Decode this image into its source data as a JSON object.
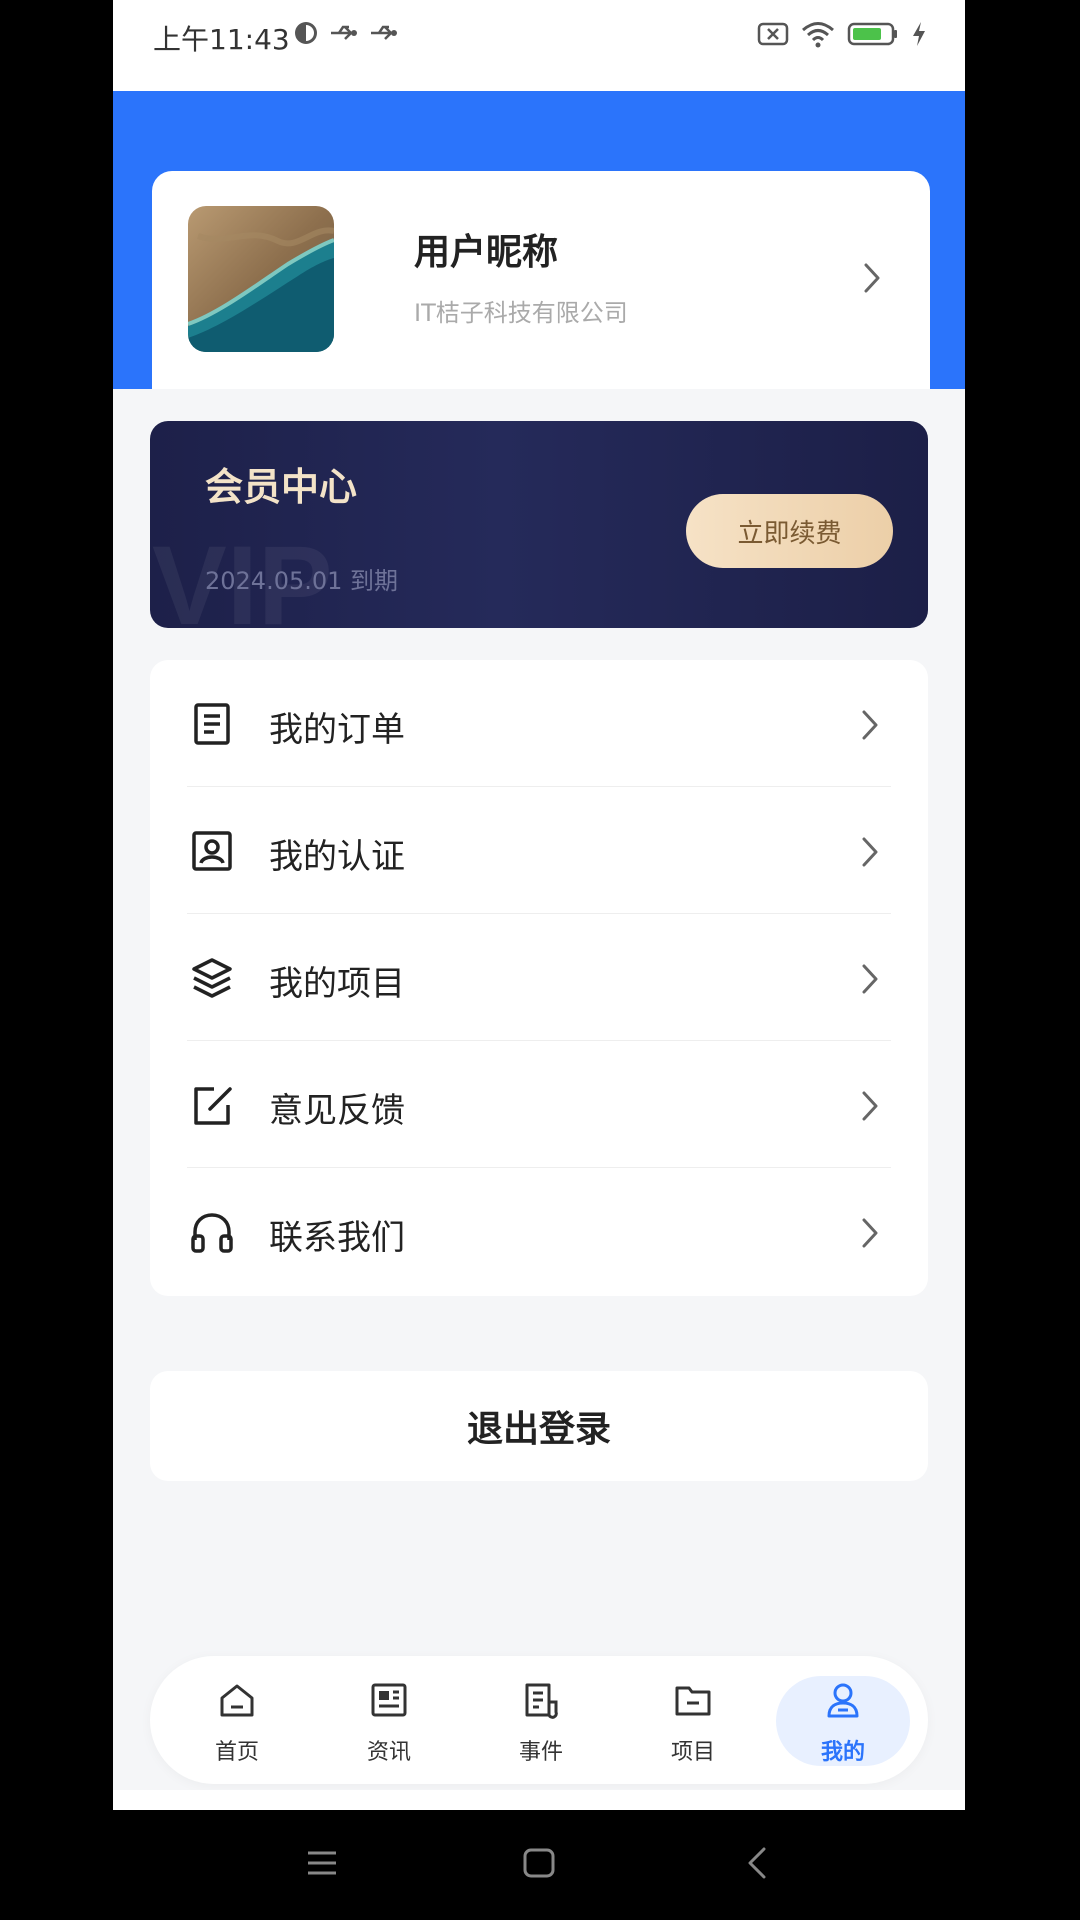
{
  "status_bar": {
    "time": "上午11:43"
  },
  "profile": {
    "nickname": "用户昵称",
    "company": "IT桔子科技有限公司"
  },
  "vip": {
    "title": "会员中心",
    "watermark": "VIP",
    "expire": "2024.05.01 到期",
    "renew_label": "立即续费"
  },
  "menu": {
    "items": [
      {
        "label": "我的订单",
        "icon": "order-icon"
      },
      {
        "label": "我的认证",
        "icon": "certification-icon"
      },
      {
        "label": "我的项目",
        "icon": "layers-icon"
      },
      {
        "label": "意见反馈",
        "icon": "feedback-icon"
      },
      {
        "label": "联系我们",
        "icon": "headphones-icon"
      }
    ]
  },
  "logout_label": "退出登录",
  "tabs": [
    {
      "label": "首页",
      "icon": "home-icon",
      "active": false
    },
    {
      "label": "资讯",
      "icon": "news-icon",
      "active": false
    },
    {
      "label": "事件",
      "icon": "event-icon",
      "active": false
    },
    {
      "label": "项目",
      "icon": "folder-icon",
      "active": false
    },
    {
      "label": "我的",
      "icon": "user-icon",
      "active": true
    }
  ],
  "colors": {
    "brand_blue": "#2b74fb",
    "vip_bg": "#1d2049",
    "vip_gold": "#f6e2c6"
  }
}
